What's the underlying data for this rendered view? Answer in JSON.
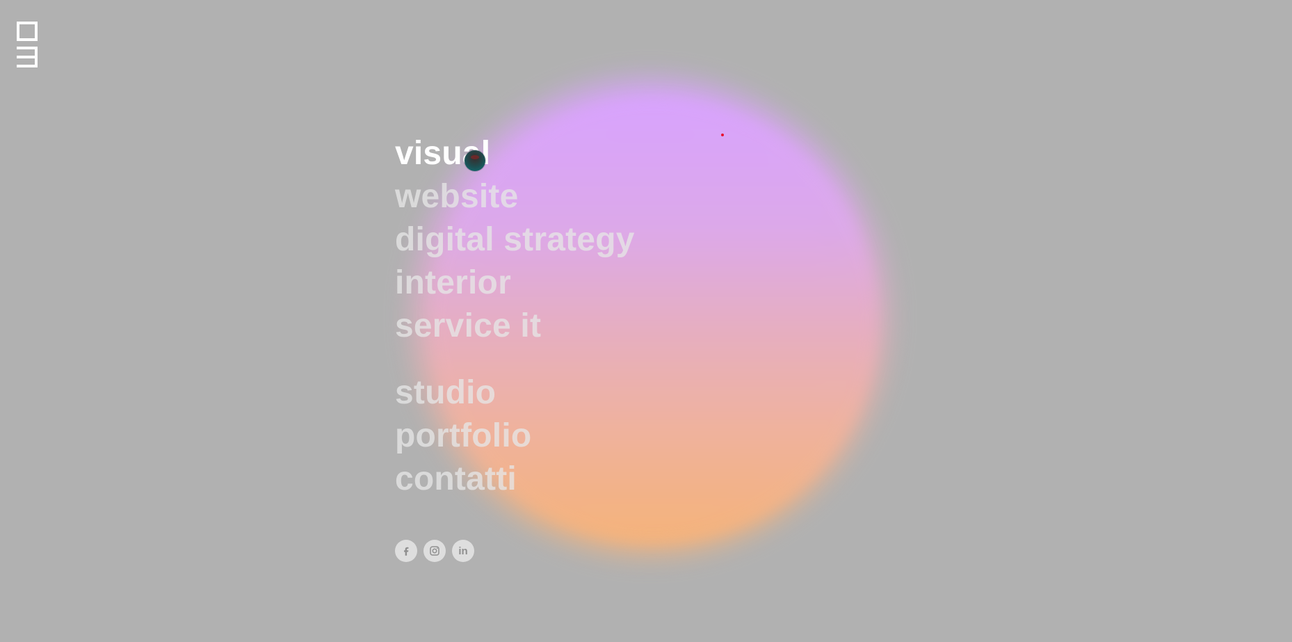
{
  "header": {
    "logo_icon": "brand-mark-icon"
  },
  "nav": {
    "primary": [
      {
        "label": "visual",
        "active": true
      },
      {
        "label": "website",
        "active": false
      },
      {
        "label": "digital strategy",
        "active": false
      },
      {
        "label": "interior",
        "active": false
      },
      {
        "label": "service it",
        "active": false
      }
    ],
    "secondary": [
      {
        "label": "studio"
      },
      {
        "label": "portfolio"
      },
      {
        "label": "contatti"
      }
    ]
  },
  "socials": [
    {
      "name": "facebook",
      "icon": "facebook-icon"
    },
    {
      "name": "instagram",
      "icon": "instagram-icon"
    },
    {
      "name": "linkedin",
      "icon": "linkedin-icon",
      "label": "in"
    }
  ],
  "colors": {
    "background": "#b1b1b1",
    "text_active": "#ffffff",
    "text_inactive": "rgba(230,230,230,0.78)",
    "orb_top": "#d9a3ff",
    "orb_bottom": "#f6b37a",
    "cursor_dot": "#117077",
    "red_dot": "#e8112d"
  }
}
